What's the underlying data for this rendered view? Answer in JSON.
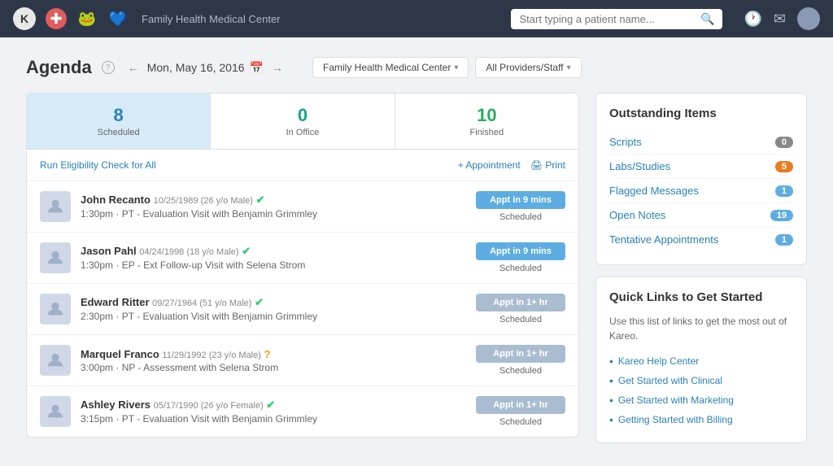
{
  "topnav": {
    "app_name": "Family Health Medical Center",
    "search_placeholder": "Start typing a patient name...",
    "logo_text": "K"
  },
  "agenda": {
    "title": "Agenda",
    "help_label": "?",
    "date": "Mon, May 16, 2016",
    "filter1": "Family Health Medical Center",
    "filter2": "All Providers/Staff"
  },
  "stats": [
    {
      "number": "8",
      "label": "Scheduled",
      "color": "blue",
      "active": true
    },
    {
      "number": "0",
      "label": "In Office",
      "color": "teal",
      "active": false
    },
    {
      "number": "10",
      "label": "Finished",
      "color": "green",
      "active": false
    }
  ],
  "toolbar": {
    "eligibility": "Run Eligibility Check for All",
    "add_appt": "+ Appointment",
    "print": "🖨 Print"
  },
  "appointments": [
    {
      "name": "John Recanto",
      "meta": "10/25/1989 (26 y/o Male)",
      "verified": true,
      "detail": "1:30pm · PT - Evaluation Visit with Benjamin Grimmley",
      "time_label": "Appt in 9 mins",
      "status": "Scheduled",
      "btn_color": "blue"
    },
    {
      "name": "Jason Pahl",
      "meta": "04/24/1998 (18 y/o Male)",
      "verified": true,
      "detail": "1:30pm · EP - Ext Follow-up Visit with Selena Strom",
      "time_label": "Appt in 9 mins",
      "status": "Scheduled",
      "btn_color": "blue"
    },
    {
      "name": "Edward Ritter",
      "meta": "09/27/1964 (51 y/o Male)",
      "verified": true,
      "detail": "2:30pm · PT - Evaluation Visit with Benjamin Grimmley",
      "time_label": "Appt in 1+ hr",
      "status": "Scheduled",
      "btn_color": "gray"
    },
    {
      "name": "Marquel Franco",
      "meta": "11/29/1992 (23 y/o Male)",
      "verified": false,
      "detail": "3:00pm · NP - Assessment with Selena Strom",
      "time_label": "Appt in 1+ hr",
      "status": "Scheduled",
      "btn_color": "gray"
    },
    {
      "name": "Ashley Rivers",
      "meta": "05/17/1990 (26 y/o Female)",
      "verified": true,
      "detail": "3:15pm · PT - Evaluation Visit with Benjamin Grimmley",
      "time_label": "Appt in 1+ hr",
      "status": "Scheduled",
      "btn_color": "gray"
    }
  ],
  "outstanding": {
    "title": "Outstanding Items",
    "items": [
      {
        "label": "Scripts",
        "count": "0",
        "badge_class": "zero"
      },
      {
        "label": "Labs/Studies",
        "count": "5",
        "badge_class": "five"
      },
      {
        "label": "Flagged Messages",
        "count": "1",
        "badge_class": ""
      },
      {
        "label": "Open Notes",
        "count": "19",
        "badge_class": ""
      },
      {
        "label": "Tentative Appointments",
        "count": "1",
        "badge_class": ""
      }
    ]
  },
  "quicklinks": {
    "title": "Quick Links to Get Started",
    "description": "Use this list of links to get the most out of Kareo.",
    "links": [
      "Kareo Help Center",
      "Get Started with Clinical",
      "Get Started with Marketing",
      "Getting Started with Billing"
    ]
  }
}
